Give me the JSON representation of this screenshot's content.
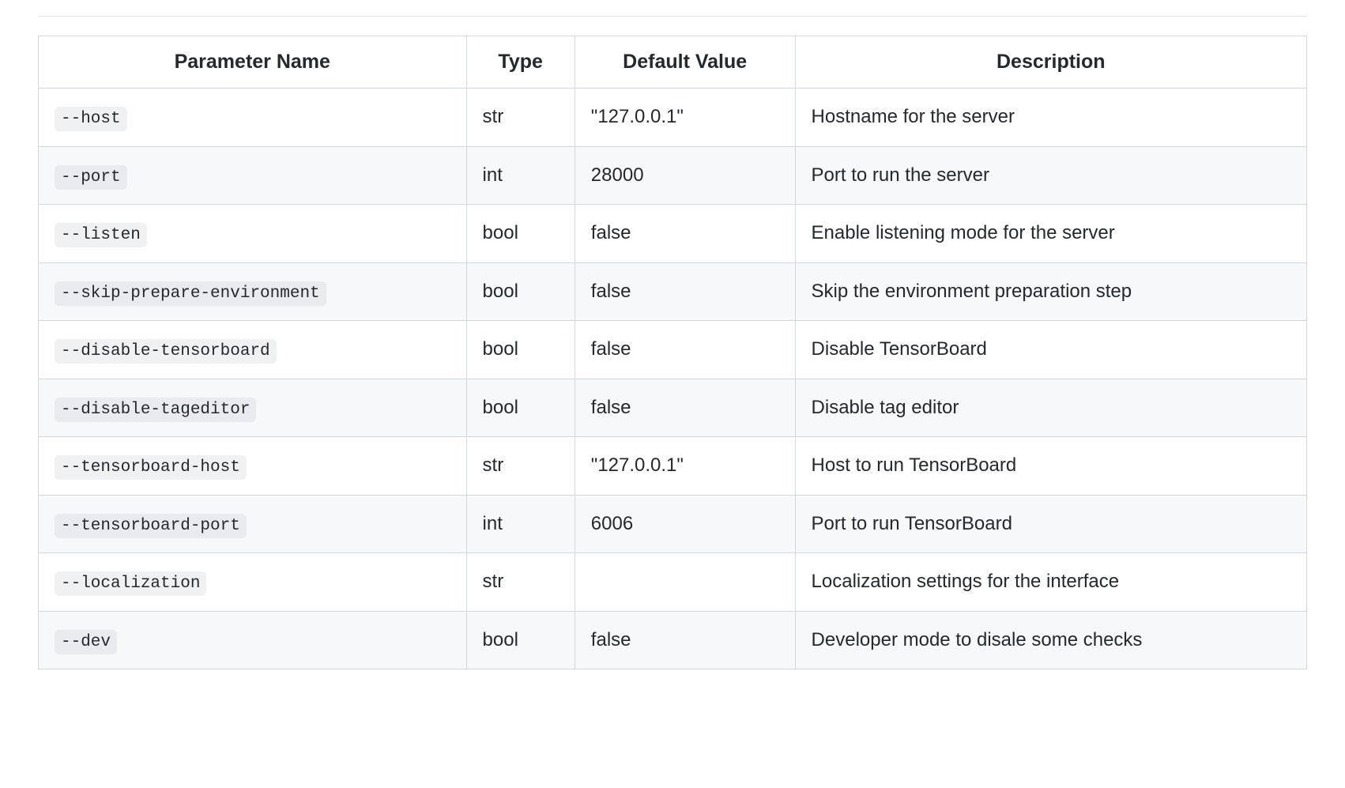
{
  "table": {
    "headers": {
      "param": "Parameter Name",
      "type": "Type",
      "default": "Default Value",
      "desc": "Description"
    },
    "rows": [
      {
        "param": "--host",
        "type": "str",
        "default": "\"127.0.0.1\"",
        "desc": "Hostname for the server"
      },
      {
        "param": "--port",
        "type": "int",
        "default": "28000",
        "desc": "Port to run the server"
      },
      {
        "param": "--listen",
        "type": "bool",
        "default": "false",
        "desc": "Enable listening mode for the server"
      },
      {
        "param": "--skip-prepare-environment",
        "type": "bool",
        "default": "false",
        "desc": "Skip the environment preparation step"
      },
      {
        "param": "--disable-tensorboard",
        "type": "bool",
        "default": "false",
        "desc": "Disable TensorBoard"
      },
      {
        "param": "--disable-tageditor",
        "type": "bool",
        "default": "false",
        "desc": "Disable tag editor"
      },
      {
        "param": "--tensorboard-host",
        "type": "str",
        "default": "\"127.0.0.1\"",
        "desc": "Host to run TensorBoard"
      },
      {
        "param": "--tensorboard-port",
        "type": "int",
        "default": "6006",
        "desc": "Port to run TensorBoard"
      },
      {
        "param": "--localization",
        "type": "str",
        "default": "",
        "desc": "Localization settings for the interface"
      },
      {
        "param": "--dev",
        "type": "bool",
        "default": "false",
        "desc": "Developer mode to disale some checks"
      }
    ]
  }
}
